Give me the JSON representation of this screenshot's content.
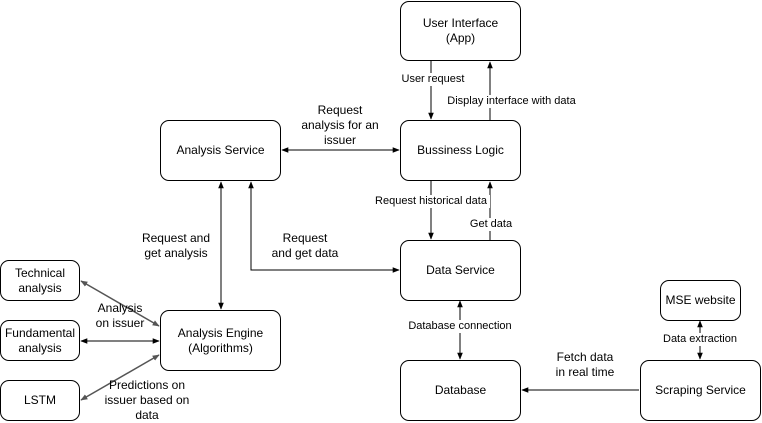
{
  "nodes": {
    "ui": "User Interface\n(App)",
    "business_logic": "Bussiness Logic",
    "analysis_service": "Analysis Service",
    "data_service": "Data Service",
    "analysis_engine": "Analysis Engine\n(Algorithms)",
    "technical": "Technical\nanalysis",
    "fundamental": "Fundamental\nanalysis",
    "lstm": "LSTM",
    "database": "Database",
    "mse": "MSE website",
    "scraping": "Scraping Service"
  },
  "labels": {
    "user_request": "User request",
    "display": "Display interface with data",
    "request_analysis": "Request\nanalysis for an\nissuer",
    "request_historical": "Request historical data",
    "get_data": "Get data",
    "request_get_analysis": "Request and\nget analysis",
    "request_get_data": "Request\nand get data",
    "analysis_on_issuer": "Analysis\non issuer",
    "predictions": "Predictions on\nissuer based on\ndata",
    "db_connection": "Database connection",
    "data_extraction": "Data extraction",
    "fetch_data": "Fetch data\nin real time"
  }
}
